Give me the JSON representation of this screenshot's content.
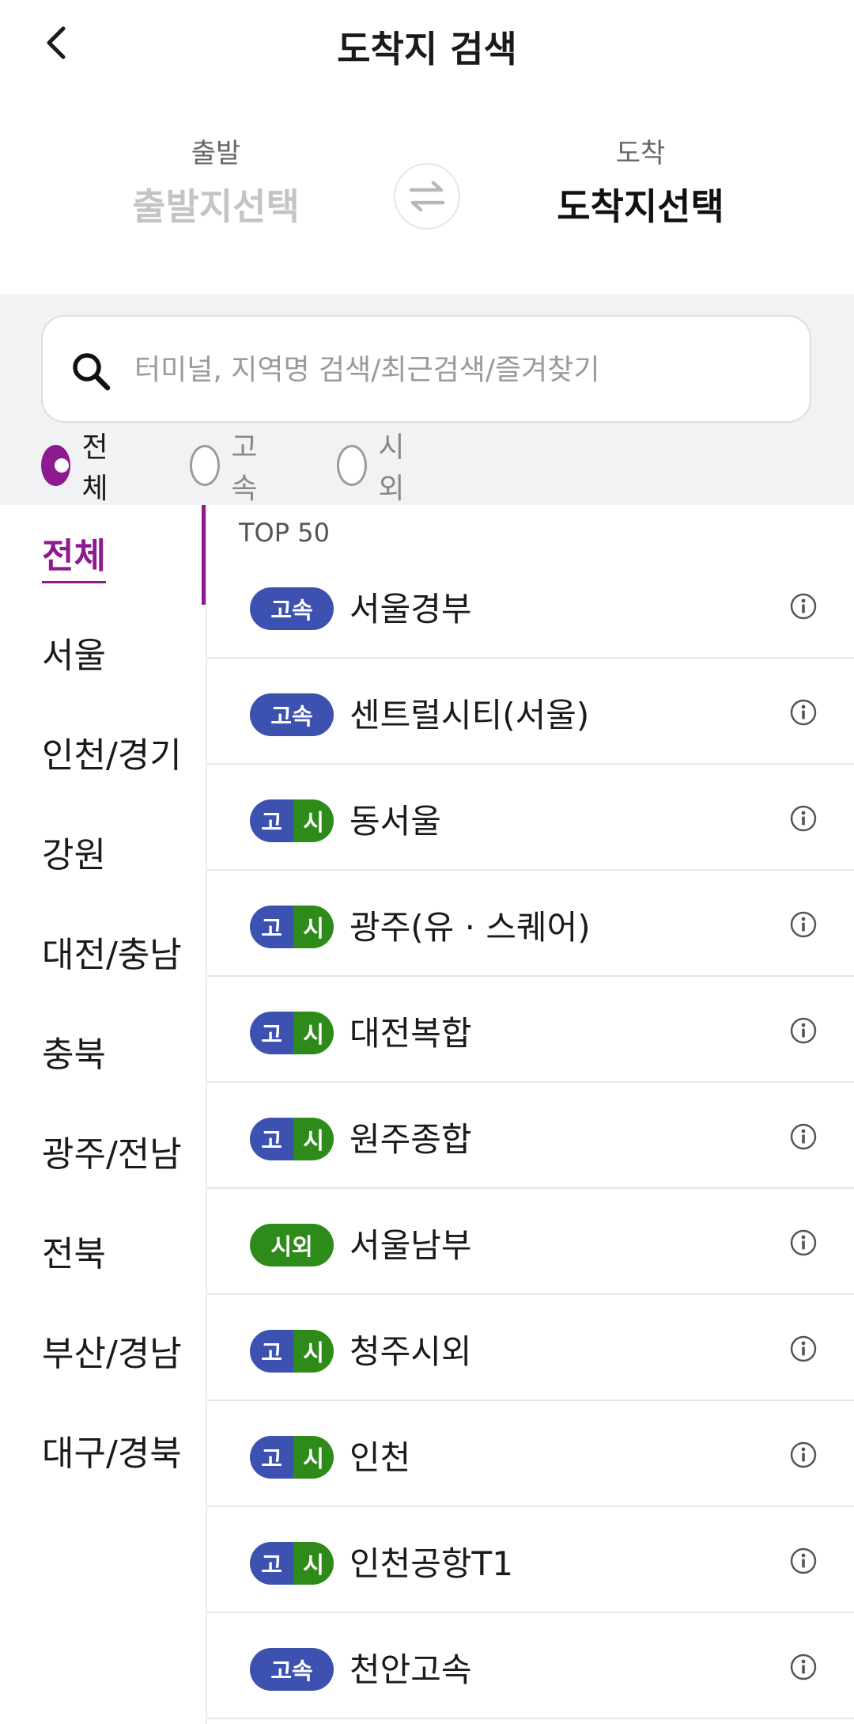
{
  "header": {
    "title": "도착지 검색",
    "back_icon": "chevron-left-icon"
  },
  "route": {
    "departure_label": "출발",
    "departure_value": "출발지선택",
    "arrival_label": "도착",
    "arrival_value": "도착지선택",
    "swap_icon": "swap-arrows-icon"
  },
  "search": {
    "placeholder": "터미널, 지역명 검색/최근검색/즐겨찾기",
    "value": ""
  },
  "filters": [
    {
      "label": "전체",
      "checked": true
    },
    {
      "label": "고속",
      "checked": false
    },
    {
      "label": "시외",
      "checked": false
    }
  ],
  "sidebar": {
    "items": [
      {
        "label": "전체",
        "active": true
      },
      {
        "label": "서울"
      },
      {
        "label": "인천/경기"
      },
      {
        "label": "강원"
      },
      {
        "label": "대전/충남"
      },
      {
        "label": "충북"
      },
      {
        "label": "광주/전남"
      },
      {
        "label": "전북"
      },
      {
        "label": "부산/경남"
      },
      {
        "label": "대구/경북"
      }
    ]
  },
  "list": {
    "heading": "TOP 50",
    "items": [
      {
        "type": "express",
        "badge": "고속",
        "name": "서울경부"
      },
      {
        "type": "express",
        "badge": "고속",
        "name": "센트럴시티(서울)"
      },
      {
        "type": "both",
        "badge_a": "고",
        "badge_b": "시",
        "name": "동서울"
      },
      {
        "type": "both",
        "badge_a": "고",
        "badge_b": "시",
        "name": "광주(유 · 스퀘어)"
      },
      {
        "type": "both",
        "badge_a": "고",
        "badge_b": "시",
        "name": "대전복합"
      },
      {
        "type": "both",
        "badge_a": "고",
        "badge_b": "시",
        "name": "원주종합"
      },
      {
        "type": "intercity",
        "badge": "시외",
        "name": "서울남부"
      },
      {
        "type": "both",
        "badge_a": "고",
        "badge_b": "시",
        "name": "청주시외"
      },
      {
        "type": "both",
        "badge_a": "고",
        "badge_b": "시",
        "name": "인천"
      },
      {
        "type": "both",
        "badge_a": "고",
        "badge_b": "시",
        "name": "인천공항T1"
      },
      {
        "type": "express",
        "badge": "고속",
        "name": "천안고속"
      }
    ]
  },
  "colors": {
    "accent": "#8e1a8f",
    "express": "#3d52b0",
    "intercity": "#2e8b1a"
  }
}
